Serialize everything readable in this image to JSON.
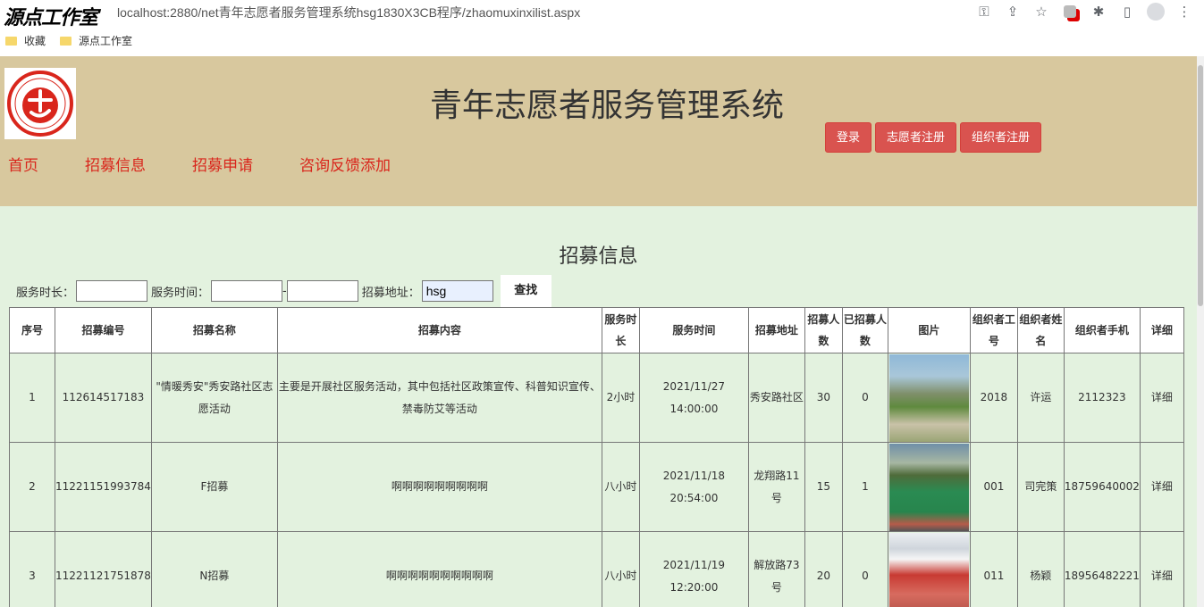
{
  "browser": {
    "watermark": "源点工作室",
    "url": "localhost:2880/net青年志愿者服务管理系统hsg1830X3CB程序/zhaomuxinxilist.aspx",
    "bookmarks": [
      {
        "label": "收藏"
      },
      {
        "label": "源点工作室"
      }
    ]
  },
  "header": {
    "title": "青年志愿者服务管理系统",
    "nav": [
      {
        "label": "首页"
      },
      {
        "label": "招募信息"
      },
      {
        "label": "招募申请"
      },
      {
        "label": "咨询反馈添加"
      }
    ],
    "buttons": {
      "login": "登录",
      "volunteer_register": "志愿者注册",
      "organizer_register": "组织者注册"
    }
  },
  "section_title": "招募信息",
  "search": {
    "duration_label": "服务时长：",
    "duration_value": "",
    "time_label": "服务时间：",
    "time_from": "",
    "time_sep": "-",
    "time_to": "",
    "address_label": "招募地址：",
    "address_value": "hsg",
    "find_label": "查找"
  },
  "table": {
    "headers": [
      "序号",
      "招募编号",
      "招募名称",
      "招募内容",
      "服务时长",
      "服务时间",
      "招募地址",
      "招募人数",
      "已招募人数",
      "图片",
      "组织者工号",
      "组织者姓名",
      "组织者手机",
      "详细"
    ],
    "rows": [
      {
        "no": "1",
        "code": "112614517183",
        "name": "\"情暖秀安\"秀安路社区志愿活动",
        "content": "主要是开展社区服务活动，其中包括社区政策宣传、科普知识宣传、禁毒防艾等活动",
        "duration": "2小时",
        "time_date": "2021/11/27",
        "time_clock": "14:00:00",
        "address": "秀安路社区",
        "quota": "30",
        "recruited": "0",
        "image": "community-garden-photo",
        "org_id": "2018",
        "org_name": "许运",
        "org_phone": "2112323",
        "detail": "详细"
      },
      {
        "no": "2",
        "code": "11221151993784",
        "name": "F招募",
        "content": "啊啊啊啊啊啊啊啊啊",
        "duration": "八小时",
        "time_date": "2021/11/18",
        "time_clock": "20:54:00",
        "address": "龙翔路11号",
        "quota": "15",
        "recruited": "1",
        "image": "green-court-photo",
        "org_id": "001",
        "org_name": "司完策",
        "org_phone": "18759640002",
        "detail": "详细"
      },
      {
        "no": "3",
        "code": "11221121751878",
        "name": "N招募",
        "content": "啊啊啊啊啊啊啊啊啊啊",
        "duration": "八小时",
        "time_date": "2021/11/19",
        "time_clock": "12:20:00",
        "address": "解放路73号",
        "quota": "20",
        "recruited": "0",
        "image": "hall-stage-photo",
        "org_id": "011",
        "org_name": "杨颖",
        "org_phone": "18956482221",
        "detail": "详细"
      }
    ]
  }
}
